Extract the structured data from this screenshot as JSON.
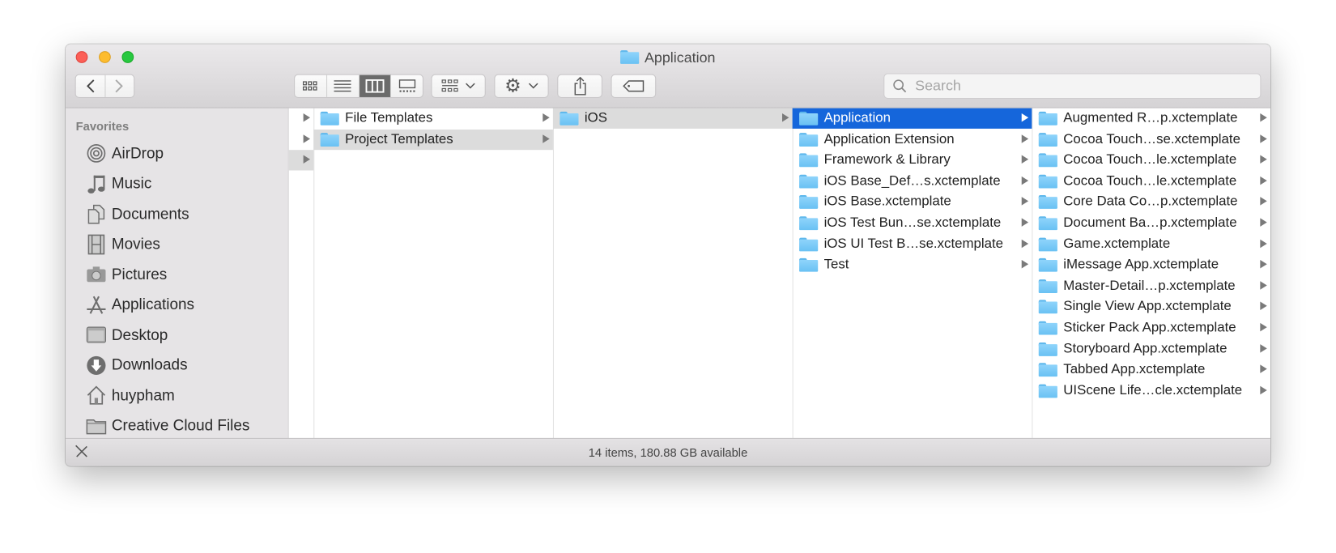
{
  "window": {
    "title": "Application"
  },
  "toolbar": {
    "back_label": "Back",
    "forward_label": "Forward",
    "views": [
      "icon-view",
      "list-view",
      "column-view",
      "gallery-view"
    ],
    "selected_view": "column-view",
    "search_placeholder": "Search"
  },
  "sidebar": {
    "section": "Favorites",
    "items": [
      {
        "label": "AirDrop",
        "icon": "airdrop-icon"
      },
      {
        "label": "Music",
        "icon": "music-icon"
      },
      {
        "label": "Documents",
        "icon": "documents-icon"
      },
      {
        "label": "Movies",
        "icon": "movies-icon"
      },
      {
        "label": "Pictures",
        "icon": "pictures-icon"
      },
      {
        "label": "Applications",
        "icon": "applications-icon"
      },
      {
        "label": "Desktop",
        "icon": "desktop-icon"
      },
      {
        "label": "Downloads",
        "icon": "downloads-icon"
      },
      {
        "label": "huypham",
        "icon": "home-icon"
      },
      {
        "label": "Creative Cloud Files",
        "icon": "folder-icon"
      }
    ]
  },
  "columns": [
    {
      "items": [
        {
          "label": "File Templates",
          "selected": ""
        },
        {
          "label": "Project Templates",
          "selected": "grey"
        }
      ]
    },
    {
      "items": [
        {
          "label": "iOS",
          "selected": "grey"
        }
      ]
    },
    {
      "items": [
        {
          "label": "Application",
          "selected": "blue"
        },
        {
          "label": "Application Extension",
          "selected": ""
        },
        {
          "label": "Framework & Library",
          "selected": ""
        },
        {
          "label": "iOS Base_Def…s.xctemplate",
          "selected": ""
        },
        {
          "label": "iOS Base.xctemplate",
          "selected": ""
        },
        {
          "label": "iOS Test Bun…se.xctemplate",
          "selected": ""
        },
        {
          "label": "iOS UI Test B…se.xctemplate",
          "selected": ""
        },
        {
          "label": "Test",
          "selected": ""
        }
      ]
    },
    {
      "items": [
        {
          "label": "Augmented R…p.xctemplate",
          "selected": ""
        },
        {
          "label": "Cocoa Touch…se.xctemplate",
          "selected": ""
        },
        {
          "label": "Cocoa Touch…le.xctemplate",
          "selected": ""
        },
        {
          "label": "Cocoa Touch…le.xctemplate",
          "selected": ""
        },
        {
          "label": "Core Data Co…p.xctemplate",
          "selected": ""
        },
        {
          "label": "Document Ba…p.xctemplate",
          "selected": ""
        },
        {
          "label": "Game.xctemplate",
          "selected": ""
        },
        {
          "label": "iMessage App.xctemplate",
          "selected": ""
        },
        {
          "label": "Master-Detail…p.xctemplate",
          "selected": ""
        },
        {
          "label": "Single View App.xctemplate",
          "selected": ""
        },
        {
          "label": "Sticker Pack App.xctemplate",
          "selected": ""
        },
        {
          "label": "Storyboard App.xctemplate",
          "selected": ""
        },
        {
          "label": "Tabbed App.xctemplate",
          "selected": ""
        },
        {
          "label": "UIScene Life…cle.xctemplate",
          "selected": ""
        }
      ]
    }
  ],
  "status": {
    "text": "14 items, 180.88 GB available"
  },
  "colors": {
    "selection": "#1566db",
    "folder": "#7ccbf7",
    "close": "#fc5f57",
    "minimize": "#fdbc2e",
    "zoom": "#28c840"
  }
}
